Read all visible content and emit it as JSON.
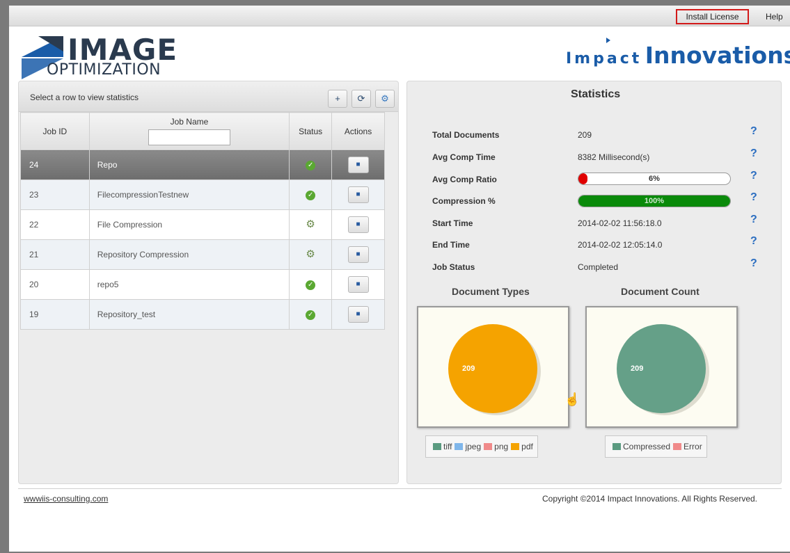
{
  "topbar": {
    "install_license": "Install License",
    "help": "Help"
  },
  "logo": {
    "image_word": "IMAGE",
    "optimization_word": "OPTIMIZATION",
    "impact": "Impact",
    "innovations": "Innovations"
  },
  "jobs_panel": {
    "title": "Select a row to view statistics",
    "columns": {
      "id": "Job ID",
      "name": "Job Name",
      "status": "Status",
      "actions": "Actions"
    },
    "filter_value": "",
    "rows": [
      {
        "id": "24",
        "name": "Repo",
        "status": "completed",
        "selected": true
      },
      {
        "id": "23",
        "name": "FilecompressionTestnew",
        "status": "completed"
      },
      {
        "id": "22",
        "name": "File Compression",
        "status": "running"
      },
      {
        "id": "21",
        "name": "Repository Compression",
        "status": "running"
      },
      {
        "id": "20",
        "name": "repo5",
        "status": "completed"
      },
      {
        "id": "19",
        "name": "Repository_test",
        "status": "completed"
      }
    ]
  },
  "statistics": {
    "title": "Statistics",
    "total_documents": {
      "label": "Total Documents",
      "value": "209"
    },
    "avg_comp_time": {
      "label": "Avg Comp Time",
      "value": "8382 Millisecond(s)"
    },
    "avg_comp_ratio": {
      "label": "Avg Comp Ratio",
      "text": "6%",
      "fraction": 0.06
    },
    "compression": {
      "label": "Compression %",
      "text": "100%",
      "fraction": 1.0
    },
    "start_time": {
      "label": "Start Time",
      "value": "2014-02-02 11:56:18.0"
    },
    "end_time": {
      "label": "End Time",
      "value": "2014-02-02 12:05:14.0"
    },
    "job_status": {
      "label": "Job Status",
      "value": "Completed"
    },
    "help_symbol": "?"
  },
  "charts": {
    "document_types": {
      "title": "Document Types",
      "slice_label": "209",
      "legend": [
        {
          "name": "tiff",
          "color": "#5a9a80"
        },
        {
          "name": "jpeg",
          "color": "#7fb6ea"
        },
        {
          "name": "png",
          "color": "#f08a8a"
        },
        {
          "name": "pdf",
          "color": "#f5a300"
        }
      ]
    },
    "document_count": {
      "title": "Document Count",
      "slice_label": "209",
      "legend": [
        {
          "name": "Compressed",
          "color": "#5a9a80"
        },
        {
          "name": "Error",
          "color": "#f08a8a"
        }
      ]
    }
  },
  "footer": {
    "link": "wwwiis-consulting.com",
    "copyright": "Copyright ©2014 Impact Innovations. All Rights Reserved."
  },
  "colors": {
    "accent": "#1a5ca8",
    "pie_orange": "#f5a300",
    "pie_green": "#65a088",
    "bar_red": "#e00000",
    "bar_green": "#0a8a0a"
  }
}
